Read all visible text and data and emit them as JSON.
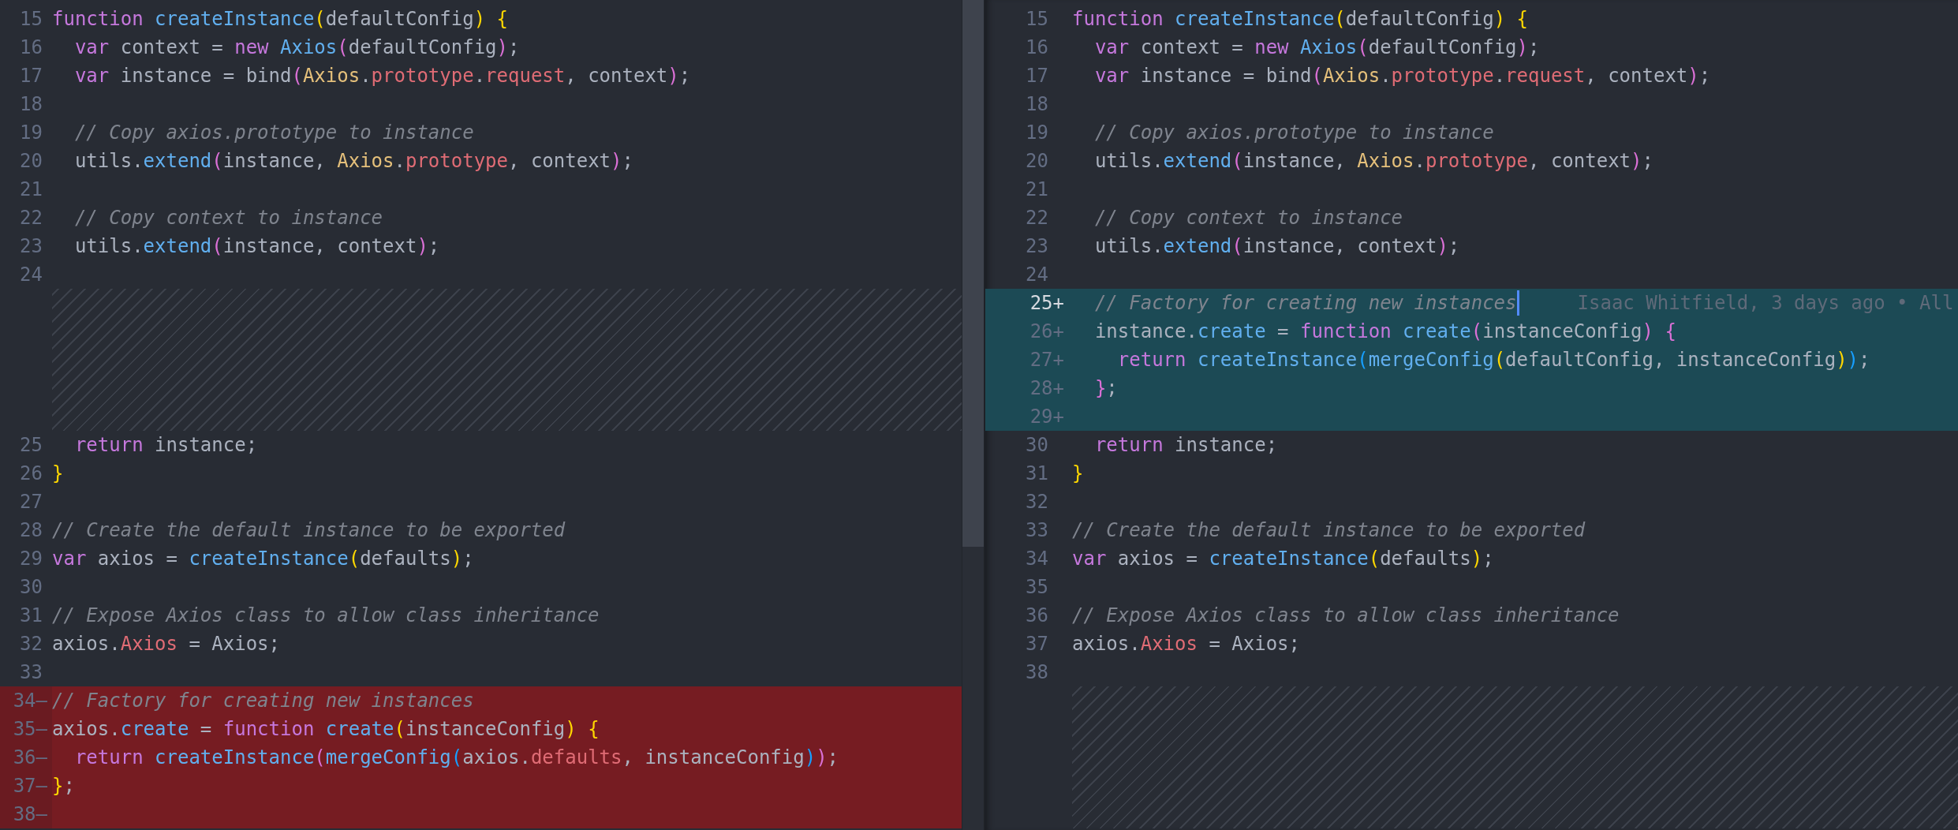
{
  "panes": [
    {
      "kind": "original",
      "lines": [
        {
          "n": "15",
          "tokens": [
            {
              "kind": "kw",
              "text": "function "
            },
            {
              "kind": "fn",
              "text": "createInstance"
            },
            {
              "kind": "b1",
              "text": "("
            },
            {
              "kind": "txt",
              "text": "defaultConfig"
            },
            {
              "kind": "b1",
              "text": ") "
            },
            {
              "kind": "b1",
              "text": "{"
            }
          ]
        },
        {
          "n": "16",
          "tokens": [
            {
              "kind": "kw",
              "text": "  var"
            },
            {
              "kind": "txt",
              "text": " context = "
            },
            {
              "kind": "kw",
              "text": "new "
            },
            {
              "kind": "fn",
              "text": "Axios"
            },
            {
              "kind": "b2",
              "text": "("
            },
            {
              "kind": "txt",
              "text": "defaultConfig"
            },
            {
              "kind": "b2",
              "text": ")"
            },
            {
              "kind": "txt",
              "text": ";"
            }
          ]
        },
        {
          "n": "17",
          "tokens": [
            {
              "kind": "kw",
              "text": "  var"
            },
            {
              "kind": "txt",
              "text": " instance = bind"
            },
            {
              "kind": "b2",
              "text": "("
            },
            {
              "kind": "cls",
              "text": "Axios"
            },
            {
              "kind": "txt",
              "text": "."
            },
            {
              "kind": "prop",
              "text": "prototype"
            },
            {
              "kind": "txt",
              "text": "."
            },
            {
              "kind": "prop",
              "text": "request"
            },
            {
              "kind": "txt",
              "text": ", context"
            },
            {
              "kind": "b2",
              "text": ")"
            },
            {
              "kind": "txt",
              "text": ";"
            }
          ]
        },
        {
          "n": "18"
        },
        {
          "n": "19",
          "tokens": [
            {
              "kind": "cmt",
              "text": "  // Copy axios.prototype to instance"
            }
          ]
        },
        {
          "n": "20",
          "tokens": [
            {
              "kind": "txt",
              "text": "  utils."
            },
            {
              "kind": "fn",
              "text": "extend"
            },
            {
              "kind": "b2",
              "text": "("
            },
            {
              "kind": "txt",
              "text": "instance, "
            },
            {
              "kind": "cls",
              "text": "Axios"
            },
            {
              "kind": "txt",
              "text": "."
            },
            {
              "kind": "prop",
              "text": "prototype"
            },
            {
              "kind": "txt",
              "text": ", context"
            },
            {
              "kind": "b2",
              "text": ")"
            },
            {
              "kind": "txt",
              "text": ";"
            }
          ]
        },
        {
          "n": "21"
        },
        {
          "n": "22",
          "tokens": [
            {
              "kind": "cmt",
              "text": "  // Copy context to instance"
            }
          ]
        },
        {
          "n": "23",
          "tokens": [
            {
              "kind": "txt",
              "text": "  utils."
            },
            {
              "kind": "fn",
              "text": "extend"
            },
            {
              "kind": "b2",
              "text": "("
            },
            {
              "kind": "txt",
              "text": "instance, context"
            },
            {
              "kind": "b2",
              "text": ")"
            },
            {
              "kind": "txt",
              "text": ";"
            }
          ]
        },
        {
          "n": "24"
        },
        {
          "kind": "filler"
        },
        {
          "kind": "filler"
        },
        {
          "kind": "filler"
        },
        {
          "kind": "filler"
        },
        {
          "kind": "filler"
        },
        {
          "n": "25",
          "tokens": [
            {
              "kind": "kw",
              "text": "  return"
            },
            {
              "kind": "txt",
              "text": " instance;"
            }
          ]
        },
        {
          "n": "26",
          "tokens": [
            {
              "kind": "b1",
              "text": "}"
            }
          ]
        },
        {
          "n": "27"
        },
        {
          "n": "28",
          "tokens": [
            {
              "kind": "cmt",
              "text": "// Create the default instance to be exported"
            }
          ]
        },
        {
          "n": "29",
          "tokens": [
            {
              "kind": "kw",
              "text": "var"
            },
            {
              "kind": "txt",
              "text": " axios = "
            },
            {
              "kind": "fn",
              "text": "createInstance"
            },
            {
              "kind": "b1",
              "text": "("
            },
            {
              "kind": "txt",
              "text": "defaults"
            },
            {
              "kind": "b1",
              "text": ")"
            },
            {
              "kind": "txt",
              "text": ";"
            }
          ]
        },
        {
          "n": "30"
        },
        {
          "n": "31",
          "tokens": [
            {
              "kind": "cmt",
              "text": "// Expose Axios class to allow class inheritance"
            }
          ]
        },
        {
          "n": "32",
          "tokens": [
            {
              "kind": "txt",
              "text": "axios."
            },
            {
              "kind": "prop",
              "text": "Axios"
            },
            {
              "kind": "txt",
              "text": " = Axios;"
            }
          ]
        },
        {
          "n": "33"
        },
        {
          "n": "34",
          "sign": "—",
          "kind": "removed",
          "tokens": [
            {
              "kind": "cmt",
              "text": "// Factory for creating new instances"
            }
          ]
        },
        {
          "n": "35",
          "sign": "—",
          "kind": "removed",
          "tokens": [
            {
              "kind": "txt",
              "text": "axios."
            },
            {
              "kind": "fn",
              "text": "create"
            },
            {
              "kind": "txt",
              "text": " = "
            },
            {
              "kind": "kw",
              "text": "function "
            },
            {
              "kind": "fn",
              "text": "create"
            },
            {
              "kind": "b1",
              "text": "("
            },
            {
              "kind": "txt",
              "text": "instanceConfig"
            },
            {
              "kind": "b1",
              "text": ") "
            },
            {
              "kind": "b1",
              "text": "{"
            }
          ]
        },
        {
          "n": "36",
          "sign": "—",
          "kind": "removed",
          "tokens": [
            {
              "kind": "kw",
              "text": "  return "
            },
            {
              "kind": "fn",
              "text": "createInstance"
            },
            {
              "kind": "b2",
              "text": "("
            },
            {
              "kind": "fn",
              "text": "mergeConfig"
            },
            {
              "kind": "b3",
              "text": "("
            },
            {
              "kind": "txt",
              "text": "axios."
            },
            {
              "kind": "prop",
              "text": "defaults"
            },
            {
              "kind": "txt",
              "text": ", instanceConfig"
            },
            {
              "kind": "b3",
              "text": ")"
            },
            {
              "kind": "b2",
              "text": ")"
            },
            {
              "kind": "txt",
              "text": ";"
            }
          ]
        },
        {
          "n": "37",
          "sign": "—",
          "kind": "removed",
          "tokens": [
            {
              "kind": "b1",
              "text": "}"
            },
            {
              "kind": "txt",
              "text": ";"
            }
          ]
        },
        {
          "n": "38",
          "sign": "—",
          "kind": "removed"
        }
      ]
    },
    {
      "kind": "modified",
      "lines": [
        {
          "n": "15",
          "tokens": [
            {
              "kind": "kw",
              "text": "function "
            },
            {
              "kind": "fn",
              "text": "createInstance"
            },
            {
              "kind": "b1",
              "text": "("
            },
            {
              "kind": "txt",
              "text": "defaultConfig"
            },
            {
              "kind": "b1",
              "text": ") "
            },
            {
              "kind": "b1",
              "text": "{"
            }
          ]
        },
        {
          "n": "16",
          "tokens": [
            {
              "kind": "kw",
              "text": "  var"
            },
            {
              "kind": "txt",
              "text": " context = "
            },
            {
              "kind": "kw",
              "text": "new "
            },
            {
              "kind": "fn",
              "text": "Axios"
            },
            {
              "kind": "b2",
              "text": "("
            },
            {
              "kind": "txt",
              "text": "defaultConfig"
            },
            {
              "kind": "b2",
              "text": ")"
            },
            {
              "kind": "txt",
              "text": ";"
            }
          ]
        },
        {
          "n": "17",
          "tokens": [
            {
              "kind": "kw",
              "text": "  var"
            },
            {
              "kind": "txt",
              "text": " instance = bind"
            },
            {
              "kind": "b2",
              "text": "("
            },
            {
              "kind": "cls",
              "text": "Axios"
            },
            {
              "kind": "txt",
              "text": "."
            },
            {
              "kind": "prop",
              "text": "prototype"
            },
            {
              "kind": "txt",
              "text": "."
            },
            {
              "kind": "prop",
              "text": "request"
            },
            {
              "kind": "txt",
              "text": ", context"
            },
            {
              "kind": "b2",
              "text": ")"
            },
            {
              "kind": "txt",
              "text": ";"
            }
          ]
        },
        {
          "n": "18"
        },
        {
          "n": "19",
          "tokens": [
            {
              "kind": "cmt",
              "text": "  // Copy axios.prototype to instance"
            }
          ]
        },
        {
          "n": "20",
          "tokens": [
            {
              "kind": "txt",
              "text": "  utils."
            },
            {
              "kind": "fn",
              "text": "extend"
            },
            {
              "kind": "b2",
              "text": "("
            },
            {
              "kind": "txt",
              "text": "instance, "
            },
            {
              "kind": "cls",
              "text": "Axios"
            },
            {
              "kind": "txt",
              "text": "."
            },
            {
              "kind": "prop",
              "text": "prototype"
            },
            {
              "kind": "txt",
              "text": ", context"
            },
            {
              "kind": "b2",
              "text": ")"
            },
            {
              "kind": "txt",
              "text": ";"
            }
          ]
        },
        {
          "n": "21"
        },
        {
          "n": "22",
          "tokens": [
            {
              "kind": "cmt",
              "text": "  // Copy context to instance"
            }
          ]
        },
        {
          "n": "23",
          "tokens": [
            {
              "kind": "txt",
              "text": "  utils."
            },
            {
              "kind": "fn",
              "text": "extend"
            },
            {
              "kind": "b2",
              "text": "("
            },
            {
              "kind": "txt",
              "text": "instance, context"
            },
            {
              "kind": "b2",
              "text": ")"
            },
            {
              "kind": "txt",
              "text": ";"
            }
          ]
        },
        {
          "n": "24"
        },
        {
          "n": "25",
          "sign": "+",
          "kind": "added",
          "current": true,
          "cursor": true,
          "blame": "Isaac Whitfield, 3 days ago • All",
          "tokens": [
            {
              "kind": "cmt",
              "text": "  // Factory for creating new instances"
            }
          ]
        },
        {
          "n": "26",
          "sign": "+",
          "kind": "added",
          "tokens": [
            {
              "kind": "txt",
              "text": "  instance."
            },
            {
              "kind": "fn",
              "text": "create"
            },
            {
              "kind": "txt",
              "text": " = "
            },
            {
              "kind": "kw",
              "text": "function "
            },
            {
              "kind": "fn",
              "text": "create"
            },
            {
              "kind": "b2",
              "text": "("
            },
            {
              "kind": "txt",
              "text": "instanceConfig"
            },
            {
              "kind": "b2",
              "text": ") "
            },
            {
              "kind": "b2",
              "text": "{"
            }
          ]
        },
        {
          "n": "27",
          "sign": "+",
          "kind": "added",
          "tokens": [
            {
              "kind": "kw",
              "text": "    return "
            },
            {
              "kind": "fn",
              "text": "createInstance"
            },
            {
              "kind": "b3",
              "text": "("
            },
            {
              "kind": "fn",
              "text": "mergeConfig"
            },
            {
              "kind": "b1",
              "text": "("
            },
            {
              "kind": "txt",
              "text": "defaultConfig, instanceConfig"
            },
            {
              "kind": "b1",
              "text": ")"
            },
            {
              "kind": "b3",
              "text": ")"
            },
            {
              "kind": "txt",
              "text": ";"
            }
          ]
        },
        {
          "n": "28",
          "sign": "+",
          "kind": "added",
          "tokens": [
            {
              "kind": "b2",
              "text": "  }"
            },
            {
              "kind": "txt",
              "text": ";"
            }
          ]
        },
        {
          "n": "29",
          "sign": "+",
          "kind": "added"
        },
        {
          "n": "30",
          "tokens": [
            {
              "kind": "kw",
              "text": "  return"
            },
            {
              "kind": "txt",
              "text": " instance;"
            }
          ]
        },
        {
          "n": "31",
          "tokens": [
            {
              "kind": "b1",
              "text": "}"
            }
          ]
        },
        {
          "n": "32"
        },
        {
          "n": "33",
          "tokens": [
            {
              "kind": "cmt",
              "text": "// Create the default instance to be exported"
            }
          ]
        },
        {
          "n": "34",
          "tokens": [
            {
              "kind": "kw",
              "text": "var"
            },
            {
              "kind": "txt",
              "text": " axios = "
            },
            {
              "kind": "fn",
              "text": "createInstance"
            },
            {
              "kind": "b1",
              "text": "("
            },
            {
              "kind": "txt",
              "text": "defaults"
            },
            {
              "kind": "b1",
              "text": ")"
            },
            {
              "kind": "txt",
              "text": ";"
            }
          ]
        },
        {
          "n": "35"
        },
        {
          "n": "36",
          "tokens": [
            {
              "kind": "cmt",
              "text": "// Expose Axios class to allow class inheritance"
            }
          ]
        },
        {
          "n": "37",
          "tokens": [
            {
              "kind": "txt",
              "text": "axios."
            },
            {
              "kind": "prop",
              "text": "Axios"
            },
            {
              "kind": "txt",
              "text": " = Axios;"
            }
          ]
        },
        {
          "n": "38"
        },
        {
          "kind": "filler"
        },
        {
          "kind": "filler"
        },
        {
          "kind": "filler"
        },
        {
          "kind": "filler"
        },
        {
          "kind": "filler"
        }
      ]
    }
  ]
}
